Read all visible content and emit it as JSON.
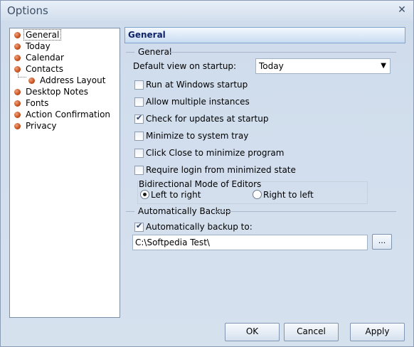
{
  "window": {
    "title": "Options",
    "close_glyph": "✕"
  },
  "tree": {
    "items": [
      {
        "label": "General"
      },
      {
        "label": "Today"
      },
      {
        "label": "Calendar"
      },
      {
        "label": "Contacts"
      },
      {
        "label": "Address Layout"
      },
      {
        "label": "Desktop Notes"
      },
      {
        "label": "Fonts"
      },
      {
        "label": "Action Confirmation"
      },
      {
        "label": "Privacy"
      }
    ],
    "selected": "General"
  },
  "header": {
    "title": "General"
  },
  "general_group": {
    "title": "General",
    "default_view_label": "Default view on startup:",
    "default_view_value": "Today",
    "checkboxes": [
      {
        "label": "Run at Windows startup",
        "checked": false
      },
      {
        "label": "Allow multiple instances",
        "checked": false
      },
      {
        "label": "Check for updates at startup",
        "checked": true
      },
      {
        "label": "Minimize to system tray",
        "checked": false
      },
      {
        "label": "Click Close to minimize program",
        "checked": false
      },
      {
        "label": "Require login from minimized state",
        "checked": false
      }
    ],
    "bidi": {
      "title": "Bidirectional Mode of Editors",
      "left_to_right": "Left to right",
      "right_to_left": "Right to left",
      "selected": "Left to right"
    }
  },
  "backup_group": {
    "title": "Automatically Backup",
    "checkbox_label": "Automatically backup to:",
    "checkbox_checked": true,
    "path_value": "C:\\Softpedia Test\\",
    "browse_label": "..."
  },
  "footer": {
    "ok": "OK",
    "cancel": "Cancel",
    "apply": "Apply"
  },
  "colors": {
    "header_text": "#10246a",
    "tree_bullet": "#c4501f",
    "window_bg": "#d6e1ee"
  }
}
